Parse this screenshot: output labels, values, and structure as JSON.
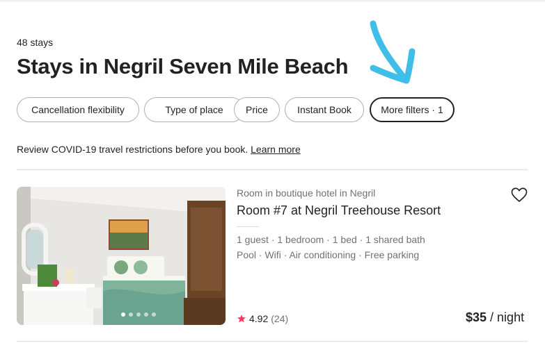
{
  "header": {
    "stays_count": "48 stays",
    "title": "Stays in Negril Seven Mile Beach"
  },
  "annotation": {
    "color": "#3fbfe8",
    "icon": "arrow-pointing-down-icon"
  },
  "filters": [
    {
      "label": "Cancellation flexibility",
      "active": false
    },
    {
      "label": "Type of place",
      "active": false
    },
    {
      "label": "Price",
      "active": false
    },
    {
      "label": "Instant Book",
      "active": false
    },
    {
      "label": "More filters · 1",
      "active": true
    }
  ],
  "covid": {
    "text": "Review COVID-19 travel restrictions before you book. ",
    "link": "Learn more"
  },
  "listing": {
    "type": "Room in boutique hotel in Negril",
    "title": "Room #7 at Negril Treehouse Resort",
    "details": "1 guest · 1 bedroom · 1 bed · 1 shared bath",
    "amenities": "Pool · Wifi · Air conditioning · Free parking",
    "rating": "4.92",
    "reviews": "(24)",
    "price": "$35",
    "price_unit": " / night",
    "photo_dots": 5,
    "active_dot": 1,
    "star_color": "#ff385c"
  }
}
